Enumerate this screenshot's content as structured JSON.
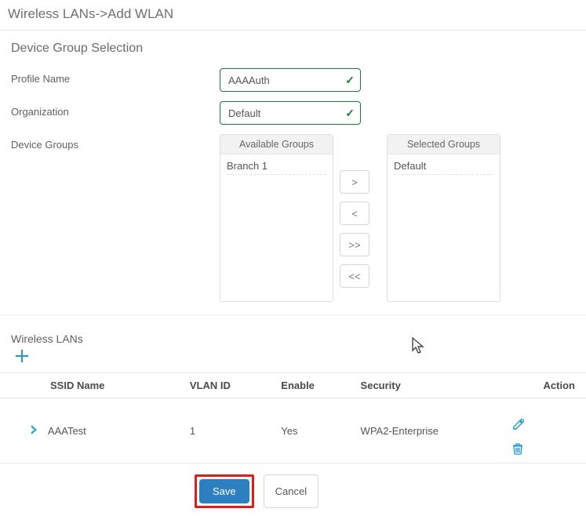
{
  "breadcrumb": "Wireless LANs->Add WLAN",
  "section_title": "Device Group Selection",
  "labels": {
    "profile_name": "Profile Name",
    "organization": "Organization",
    "device_groups": "Device Groups"
  },
  "fields": {
    "profile_name": "AAAAuth",
    "organization": "Default"
  },
  "groups": {
    "available_header": "Available Groups",
    "selected_header": "Selected Groups",
    "available": [
      "Branch 1"
    ],
    "selected": [
      "Default"
    ]
  },
  "transfer": {
    "right": ">",
    "left": "<",
    "all_right": ">>",
    "all_left": "<<"
  },
  "wlans": {
    "title": "Wireless LANs",
    "columns": {
      "ssid": "SSID Name",
      "vlan": "VLAN ID",
      "enable": "Enable",
      "security": "Security",
      "action": "Action"
    },
    "rows": [
      {
        "ssid": "AAATest",
        "vlan": "1",
        "enable": "Yes",
        "security": "WPA2-Enterprise"
      }
    ]
  },
  "buttons": {
    "save": "Save",
    "cancel": "Cancel"
  }
}
